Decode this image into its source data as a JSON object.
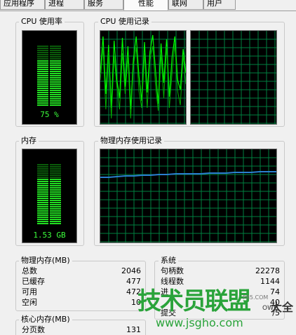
{
  "tabs": [
    {
      "label": "应用程序"
    },
    {
      "label": "进程"
    },
    {
      "label": "服务"
    },
    {
      "label": "性能"
    },
    {
      "label": "联网"
    },
    {
      "label": "用户"
    }
  ],
  "cpu_usage": {
    "label": "CPU 使用率",
    "value_text": "75 %",
    "fraction": 0.75
  },
  "cpu_history": {
    "label": "CPU 使用记录"
  },
  "memory": {
    "label": "内存",
    "value_text": "1.53 GB",
    "fraction": 0.75
  },
  "memory_history": {
    "label": "物理内存使用记录"
  },
  "physical_memory": {
    "label": "物理内存(MB)",
    "rows": [
      {
        "key": "总数",
        "value": "2046"
      },
      {
        "key": "已缓存",
        "value": "477"
      },
      {
        "key": "可用",
        "value": "472"
      },
      {
        "key": "空闲",
        "value": "10"
      }
    ]
  },
  "system": {
    "label": "系统",
    "rows": [
      {
        "key": "句柄数",
        "value": "22278"
      },
      {
        "key": "线程数",
        "value": "1144"
      },
      {
        "key": "进",
        "value": "74"
      },
      {
        "key": "",
        "value": "40"
      },
      {
        "key": "提交",
        "value": "/5"
      }
    ]
  },
  "kernel_memory": {
    "label": "核心内存(MB)",
    "rows": [
      {
        "key": "分页数",
        "value": "131"
      }
    ]
  },
  "watermark": {
    "logo_text": "技术员联盟",
    "url_text": "www.jsgho.com",
    "small_url": "P85.COM",
    "suffix": "大全",
    "fragment": "OWE"
  },
  "colors": {
    "meter_green": "#22dd22",
    "meter_dim": "#0a5a0a",
    "grid": "#008040",
    "cpu_line": "#00ff00",
    "mem_line": "#2a7fd0",
    "watermark_green": "#2aa33a"
  }
}
